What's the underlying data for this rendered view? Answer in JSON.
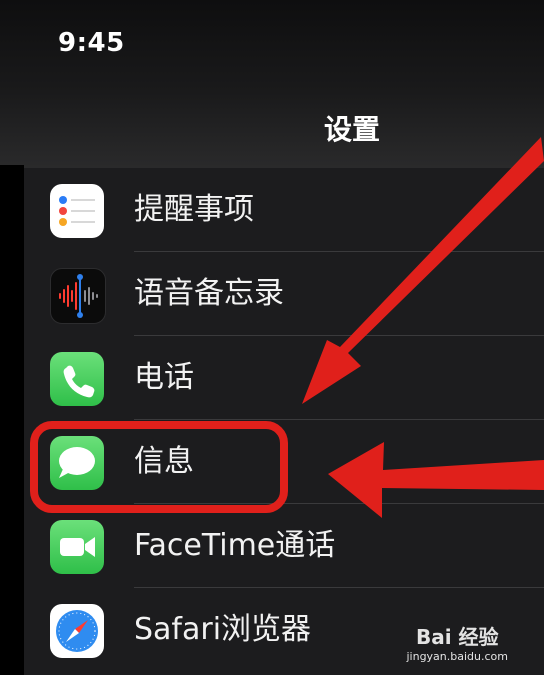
{
  "status_bar": {
    "time": "9:45"
  },
  "nav": {
    "title": "设置"
  },
  "settings_items": [
    {
      "label": "提醒事项",
      "icon": "reminders-icon"
    },
    {
      "label": "语音备忘录",
      "icon": "voice-memos-icon"
    },
    {
      "label": "电话",
      "icon": "phone-icon"
    },
    {
      "label": "信息",
      "icon": "messages-icon",
      "highlighted": true
    },
    {
      "label": "FaceTime通话",
      "icon": "facetime-icon"
    },
    {
      "label": "Safari浏览器",
      "icon": "safari-icon"
    }
  ],
  "watermark": {
    "brand": "Bai 经验",
    "url": "jingyan.baidu.com"
  },
  "colors": {
    "annotation_red": "#e0201b",
    "green_app": "#34c759",
    "background": "#1c1c1e"
  }
}
